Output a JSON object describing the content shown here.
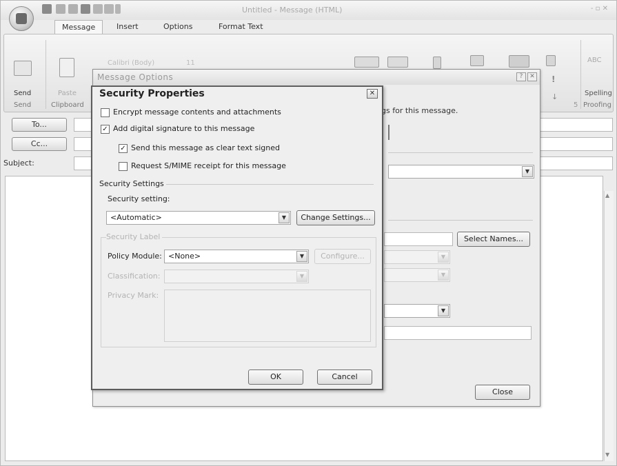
{
  "window": {
    "title": "Untitled - Message (HTML)",
    "controls": "- ▫ ✕"
  },
  "tabs": [
    "Message",
    "Insert",
    "Options",
    "Format Text"
  ],
  "ribbon": {
    "send_label": "Send",
    "paste_label": "Paste",
    "font_name": "Calibri (Body)",
    "font_size": "11",
    "spelling_label": "Spelling",
    "groups": [
      "Send",
      "Clipboard",
      "Proofing"
    ],
    "launcher_glyph": "5",
    "abc_label": "ABC"
  },
  "address": {
    "to_label": "To...",
    "cc_label": "Cc...",
    "subject_label": "Subject:"
  },
  "message_options": {
    "title": "Message Options",
    "settings_text": "gs for this message.",
    "select_names": "Select Names...",
    "close": "Close"
  },
  "security_properties": {
    "title": "Security Properties",
    "encrypt": {
      "label": "Encrypt message contents and attachments",
      "checked": false
    },
    "sign": {
      "label": "Add digital signature to this message",
      "checked": true
    },
    "clear_text": {
      "label": "Send this message as clear text signed",
      "checked": true
    },
    "smime_receipt": {
      "label": "Request S/MIME receipt for this message",
      "checked": false
    },
    "security_settings_group": "Security Settings",
    "security_setting_label": "Security setting:",
    "security_setting_value": "<Automatic>",
    "change_settings": "Change Settings...",
    "security_label_group": "Security Label",
    "policy_module_label": "Policy Module:",
    "policy_module_value": "<None>",
    "configure": "Configure...",
    "classification_label": "Classification:",
    "privacy_mark_label": "Privacy Mark:",
    "ok": "OK",
    "cancel": "Cancel"
  }
}
